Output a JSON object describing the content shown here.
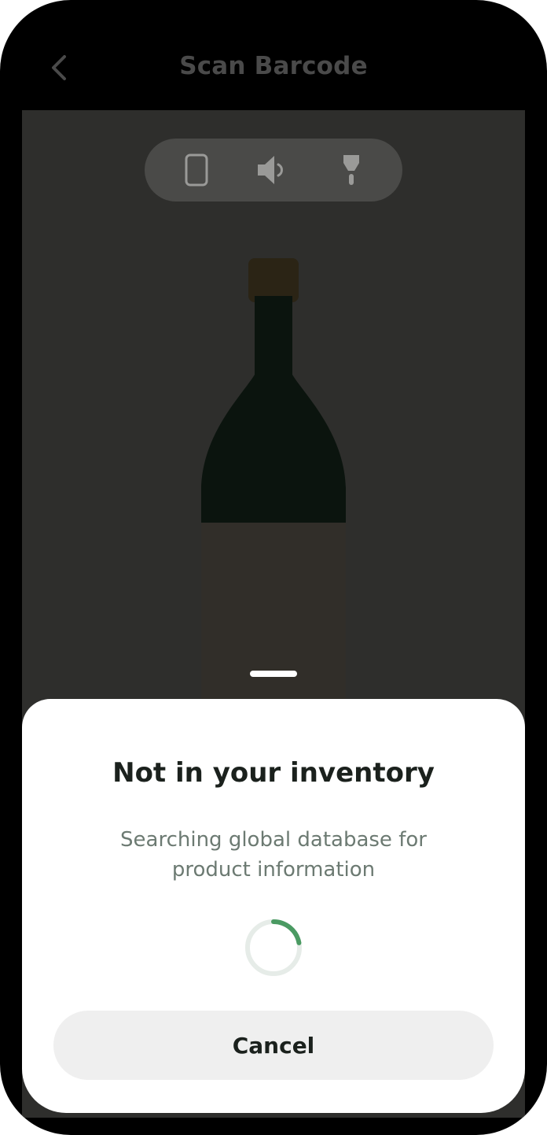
{
  "header": {
    "title": "Scan Barcode",
    "back_icon": "chevron-left-icon"
  },
  "toolbar": {
    "items": [
      {
        "icon": "phone-outline-icon"
      },
      {
        "icon": "speaker-icon"
      },
      {
        "icon": "flashlight-icon"
      }
    ]
  },
  "sheet": {
    "title": "Not in your inventory",
    "subtitle_line1": "Searching global database for",
    "subtitle_line2": "product information",
    "progress": 0.22,
    "cancel_label": "Cancel"
  },
  "colors": {
    "accent": "#4a9a62",
    "camera_bg": "#2e2e2c",
    "sheet_bg": "#ffffff",
    "title_text": "#1b211d",
    "subtitle_text": "#6c7a72",
    "cancel_bg": "#efefef"
  }
}
